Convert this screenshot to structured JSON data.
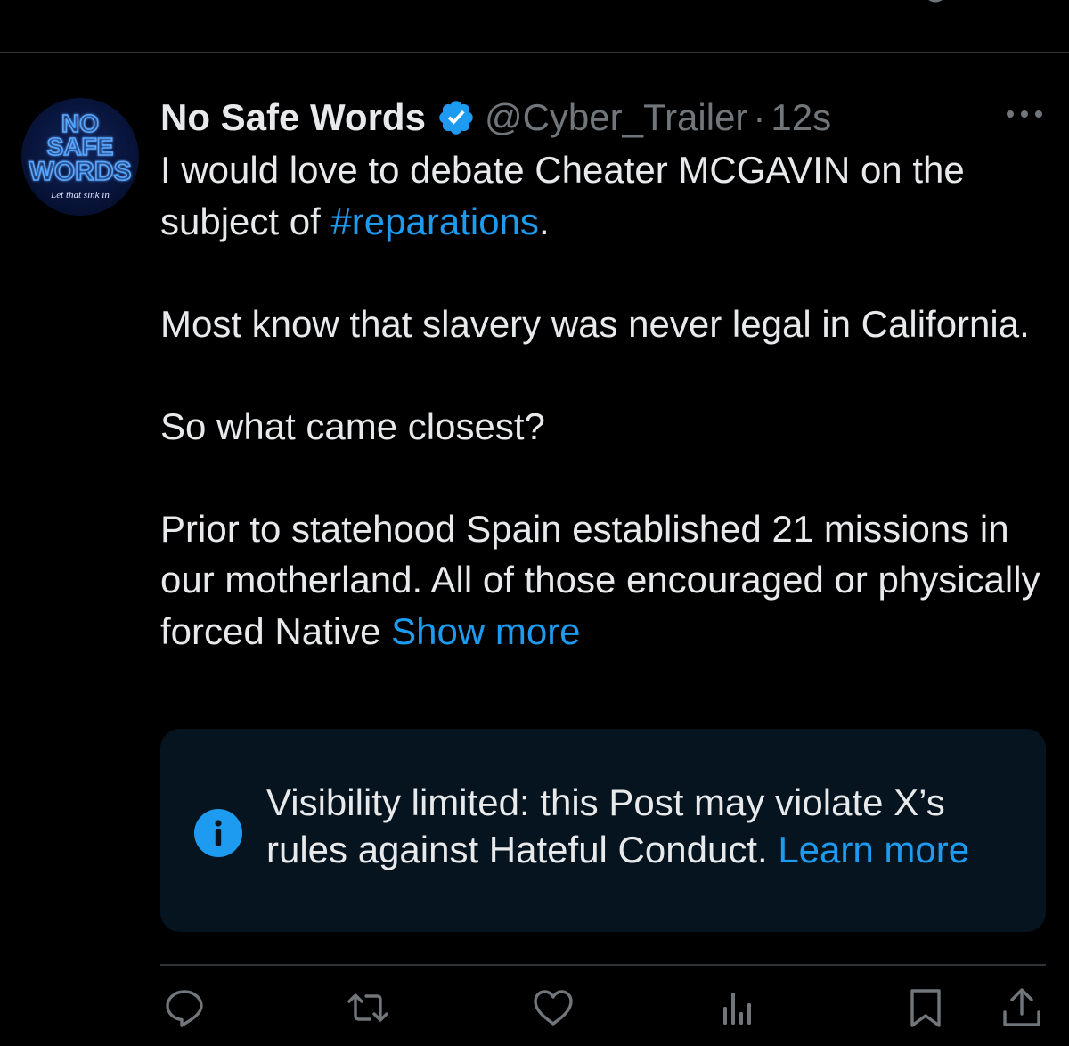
{
  "post": {
    "author": {
      "display_name": "No Safe Words",
      "handle": "@Cyber_Trailer",
      "verified": true,
      "avatar": {
        "line1": "NO",
        "line2": "SAFE",
        "line3": "WORDS",
        "tagline": "Let that sink in"
      }
    },
    "separator": "·",
    "timestamp": "12s",
    "text": {
      "p1_before": "I would love to debate Cheater MCGAVIN on the subject of ",
      "p1_hashtag": "#reparations",
      "p1_after": ".",
      "p2": "Most know that slavery was never legal in California.",
      "p3": "So what came closest?",
      "p4": "Prior to statehood Spain established 21 missions in our motherland.  All of those encouraged or physically forced Native ",
      "show_more": "Show more"
    },
    "notice": {
      "text": "Visibility limited: this Post may violate X’s rules against Hateful Conduct. ",
      "link": "Learn more"
    },
    "actions": [
      "reply-icon",
      "repost-icon",
      "like-icon",
      "views-icon",
      "bookmark-icon",
      "share-icon"
    ]
  },
  "colors": {
    "background": "#000000",
    "text_primary": "#e7e9ea",
    "text_secondary": "#71767b",
    "accent": "#1d9bf0",
    "notice_bg": "#061420",
    "divider": "#2f3336"
  }
}
